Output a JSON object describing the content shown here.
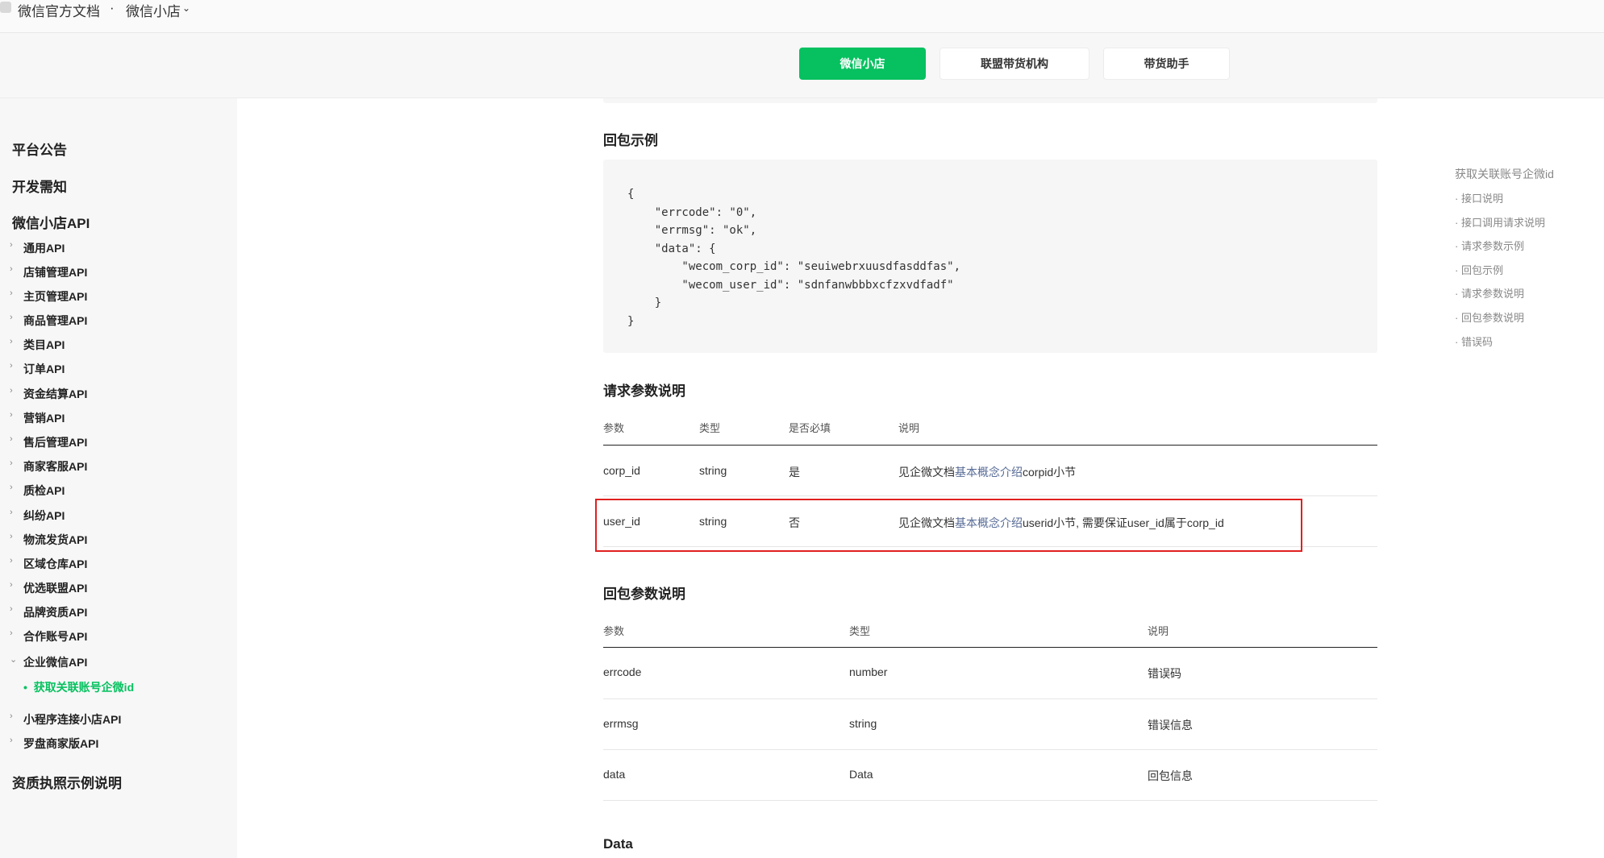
{
  "header": {
    "site_name": "微信官方文档",
    "separator": "·",
    "product_name": "微信小店",
    "dropdown_glyph": "⌄"
  },
  "tabs": [
    {
      "label": "微信小店",
      "active": true
    },
    {
      "label": "联盟带货机构",
      "active": false
    },
    {
      "label": "带货助手",
      "active": false
    }
  ],
  "sidebar": {
    "platform_notice": "平台公告",
    "dev_notes": "开发需知",
    "api_section": "微信小店API",
    "arrow_glyph": "›",
    "open_arrow_glyph": "⌄",
    "items": [
      "通用API",
      "店铺管理API",
      "主页管理API",
      "商品管理API",
      "类目API",
      "订单API",
      "资金结算API",
      "营销API",
      "售后管理API",
      "商家客服API",
      "质检API",
      "纠纷API",
      "物流发货API",
      "区域仓库API",
      "优选联盟API",
      "品牌资质API",
      "合作账号API",
      "企业微信API"
    ],
    "sub_item": "获取关联账号企微id",
    "sub_bullet": "•",
    "items2": [
      "小程序连接小店API",
      "罗盘商家版API"
    ],
    "license_section": "资质执照示例说明"
  },
  "content": {
    "response_example_title": "回包示例",
    "code_lines": [
      "{",
      "    \"errcode\": \"0\",",
      "    \"errmsg\": \"ok\",",
      "    \"data\": {",
      "        \"wecom_corp_id\": \"seuiwebrxuusdfasddfas\",",
      "        \"wecom_user_id\": \"sdnfanwbbbxcfzxvdfadf\"",
      "    }",
      "}"
    ],
    "request_params_title": "请求参数说明",
    "request_headers": [
      "参数",
      "类型",
      "是否必填",
      "说明"
    ],
    "request_rows": [
      {
        "param": "corp_id",
        "type": "string",
        "required": "是",
        "desc_prefix": "见企微文档",
        "desc_link": "基本概念介绍",
        "desc_suffix": "corpid小节"
      },
      {
        "param": "user_id",
        "type": "string",
        "required": "否",
        "desc_prefix": "见企微文档",
        "desc_link": "基本概念介绍",
        "desc_suffix": "userid小节, 需要保证user_id属于corp_id"
      }
    ],
    "response_params_title": "回包参数说明",
    "response_headers": [
      "参数",
      "类型",
      "说明"
    ],
    "response_rows": [
      {
        "param": "errcode",
        "type": "number",
        "desc": "错误码"
      },
      {
        "param": "errmsg",
        "type": "string",
        "desc": "错误信息"
      },
      {
        "param": "data",
        "type": "Data",
        "desc": "回包信息"
      }
    ],
    "data_title": "Data"
  },
  "toc": {
    "title": "获取关联账号企微id",
    "items": [
      "· 接口说明",
      "· 接口调用请求说明",
      "· 请求参数示例",
      "· 回包示例",
      "· 请求参数说明",
      "· 回包参数说明",
      "· 错误码"
    ]
  },
  "colors": {
    "accent": "#07c160",
    "link": "#576b95",
    "highlight": "#e02020"
  }
}
